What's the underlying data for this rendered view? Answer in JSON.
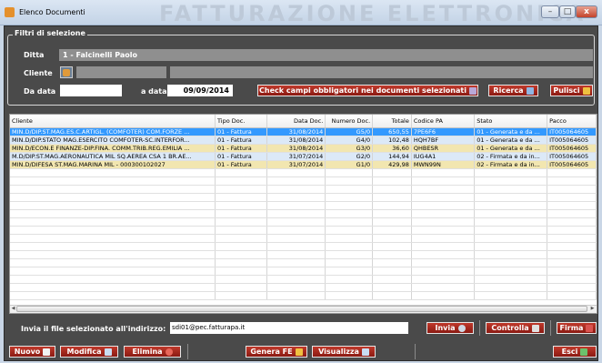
{
  "window": {
    "title": "Elenco Documenti",
    "watermark": "FATTURAZIONE ELETTRONICA",
    "min": "–",
    "max": "□",
    "close": "x"
  },
  "filters": {
    "group_title": "Filtri di selezione",
    "ditta_label": "Ditta",
    "ditta_value": "1 - Falcinelli Paolo",
    "cliente_label": "Cliente",
    "da_data_label": "Da data",
    "da_data_value": "",
    "a_data_label": "a data",
    "a_data_value": "09/09/2014",
    "check_button": "Check campi obbligatori nei documenti selezionati",
    "ricerca_button": "Ricerca",
    "pulisci_button": "Pulisci"
  },
  "table": {
    "columns": [
      "Cliente",
      "Tipo Doc.",
      "Data Doc.",
      "Numero Doc.",
      "Totale",
      "Codice PA",
      "Stato",
      "Pacco"
    ],
    "rows": [
      [
        "MIN.D/DIP.ST.MAG.ES.C.ARTIGL. (COMFOTER) COM.FORZE ...",
        "01 - Fattura",
        "31/08/2014",
        "G5/0",
        "650,55",
        "7PE6F6",
        "01 - Generata e da ...",
        "IT005064605"
      ],
      [
        "MIN.D/DIP.STATO MAG.ESERCITO COMFOTER-SC.INTERFOR...",
        "01 - Fattura",
        "31/08/2014",
        "G4/0",
        "102,48",
        "HQH7BF",
        "01 - Generata e da ...",
        "IT005064605"
      ],
      [
        "MIN.D/ECON.E FINANZE-DIP.FINA. COMM.TRIB.REG.EMILIA ...",
        "01 - Fattura",
        "31/08/2014",
        "G3/0",
        "36,60",
        "QHBESR",
        "01 - Generata e da ...",
        "IT005064605"
      ],
      [
        "M.D/DIP.ST.MAG.AERONAUTICA MIL SQ.AEREA CSA 1 BR.AE...",
        "01 - Fattura",
        "31/07/2014",
        "G2/0",
        "144,94",
        "IUG4A1",
        "02 - Firmata e da in...",
        "IT005064605"
      ],
      [
        "MIN.D/DIFESA ST.MAG.MARINA MIL - 000300102027",
        "01 - Fattura",
        "31/07/2014",
        "G1/0",
        "429,98",
        "MWN99N",
        "02 - Firmata e da in...",
        "IT005064605"
      ]
    ],
    "empty_rows": 16
  },
  "send": {
    "label": "Invia il file selezionato all'indirizzo:",
    "address": "sdi01@pec.fatturapa.it",
    "invia_button": "Invia",
    "controlla_button": "Controlla",
    "firma_button": "Firma"
  },
  "actions": {
    "nuovo": "Nuovo",
    "modifica": "Modifica",
    "elimina": "Elimina",
    "genera": "Genera FE",
    "visualizza": "Visualizza",
    "esci": "Esci"
  },
  "colors": {
    "row_selected": "#3399ff",
    "row_alt_blue": "#dce9f7",
    "row_yellow": "#f2e6b0",
    "button_red": "#a8261a"
  }
}
